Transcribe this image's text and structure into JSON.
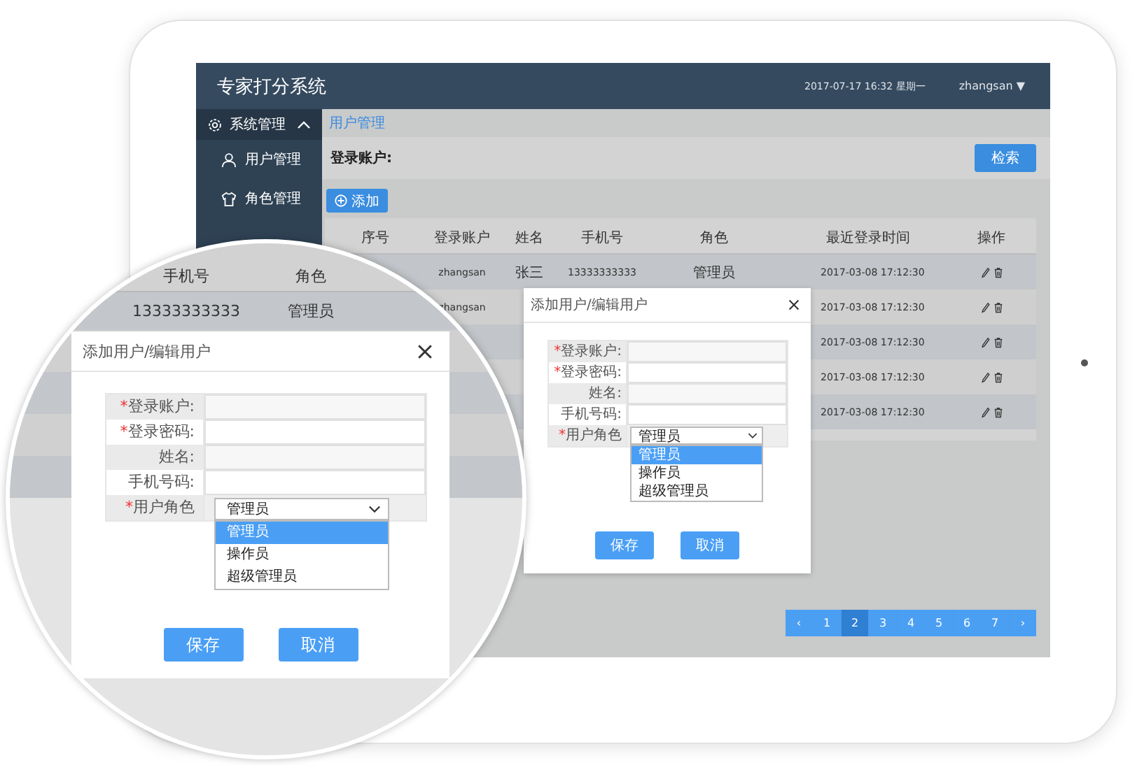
{
  "header": {
    "title": "专家打分系统",
    "datetime": "2017-07-17  16:32  星期一",
    "user": "zhangsan",
    "user_caret": "▼"
  },
  "sidebar": {
    "group": {
      "label": "系统管理",
      "expanded": true
    },
    "items": [
      {
        "label": "用户管理"
      },
      {
        "label": "角色管理"
      }
    ]
  },
  "breadcrumb": "用户管理",
  "search": {
    "label": "登录账户:",
    "button": "检索"
  },
  "add_button": "添加",
  "table": {
    "columns": [
      "序号",
      "登录账户",
      "姓名",
      "手机号",
      "角色",
      "最近登录时间",
      "操作"
    ],
    "rows": [
      {
        "account": "zhangsan",
        "name": "张三",
        "phone": "13333333333",
        "role": "管理员",
        "time": "2017-03-08 17:12:30"
      },
      {
        "account": "zhangsan",
        "time": "2017-03-08 17:12:30"
      },
      {
        "time": "2017-03-08 17:12:30"
      },
      {
        "time": "2017-03-08 17:12:30"
      },
      {
        "time": "2017-03-08 17:12:30"
      }
    ]
  },
  "pagination": {
    "prev": "‹",
    "next": "›",
    "pages": [
      {
        "label": "1",
        "selected": false
      },
      {
        "label": "2",
        "selected": true
      },
      {
        "label": "3",
        "selected": false
      },
      {
        "label": "4",
        "selected": false
      },
      {
        "label": "5",
        "selected": false
      },
      {
        "label": "6",
        "selected": false
      },
      {
        "label": "7",
        "selected": false
      }
    ]
  },
  "dialog": {
    "title": "添加用户/编辑用户",
    "fields": [
      {
        "kind": "text",
        "mark": "*",
        "label": "登录账户:"
      },
      {
        "kind": "text",
        "mark": "*",
        "label": "登录密码:"
      },
      {
        "kind": "text",
        "label": "姓名:"
      },
      {
        "kind": "text",
        "label": "手机号码:"
      },
      {
        "kind": "select",
        "mark": "*",
        "label": "用户角色",
        "value": "管理员",
        "open": true,
        "options": [
          {
            "label": "管理员",
            "selected": true
          },
          {
            "label": "操作员",
            "selected": false
          },
          {
            "label": "超级管理员",
            "selected": false
          }
        ]
      }
    ],
    "buttons": [
      "保存",
      "取消"
    ]
  },
  "magnifier": {
    "table": {
      "columns": [
        "手机号",
        "角色"
      ],
      "row": [
        "13333333333",
        "管理员"
      ]
    },
    "dialog": {
      "title": "添加用户/编辑用户",
      "fields": [
        {
          "kind": "text",
          "mark": "*",
          "label": "登录账户:"
        },
        {
          "kind": "text",
          "mark": "*",
          "label": "登录密码:"
        },
        {
          "kind": "text",
          "label": "姓名:"
        },
        {
          "kind": "text",
          "label": "手机号码:"
        },
        {
          "kind": "select",
          "mark": "*",
          "label": "用户角色",
          "value": "管理员",
          "open": true,
          "options": [
            {
              "label": "管理员",
              "selected": true
            },
            {
              "label": "操作员",
              "selected": false
            },
            {
              "label": "超级管理员",
              "selected": false
            }
          ]
        }
      ],
      "buttons": [
        "保存",
        "取消"
      ]
    }
  }
}
